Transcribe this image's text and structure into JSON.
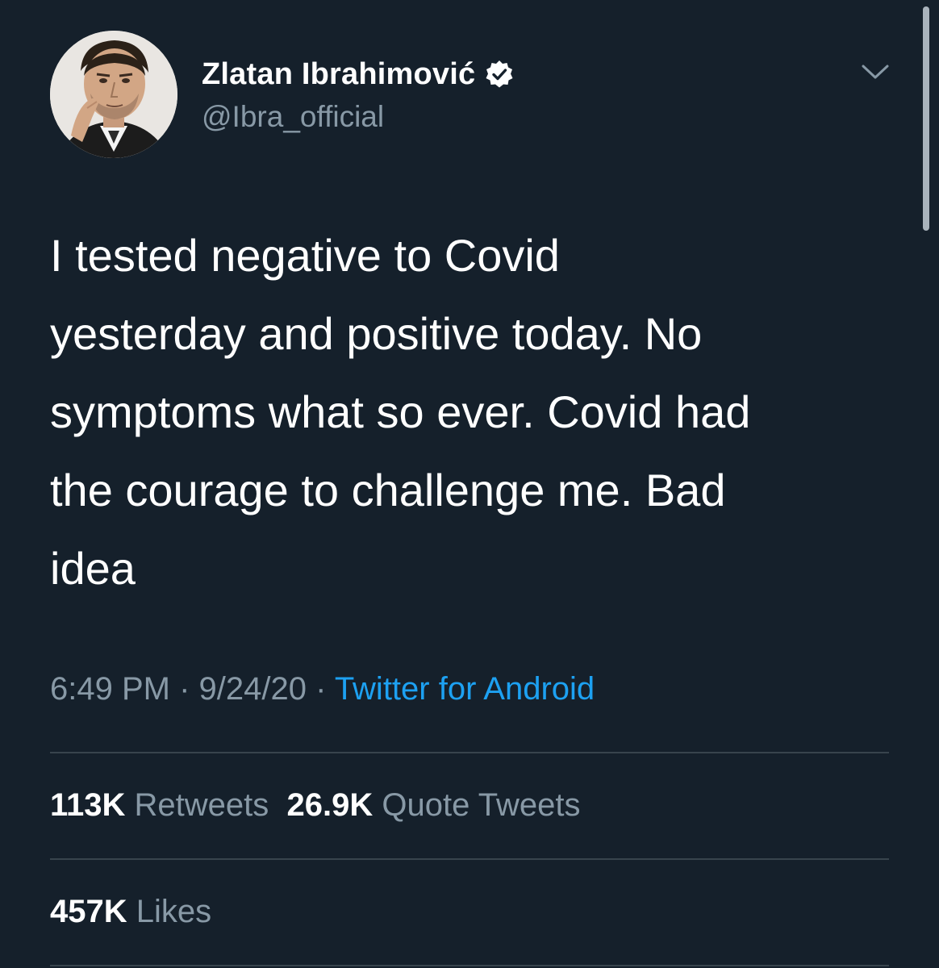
{
  "user": {
    "display_name": "Zlatan Ibrahimović",
    "handle": "@Ibra_official"
  },
  "tweet": {
    "text": "I tested negative to Covid\nyesterday and positive today. No\nsymptoms what so ever. Covid had\nthe courage to challenge me. Bad\nidea",
    "time": "6:49 PM",
    "separator": " · ",
    "date": "9/24/20",
    "source": "Twitter for Android"
  },
  "stats": {
    "retweets_count": "113K",
    "retweets_label": "Retweets",
    "quotes_count": "26.9K",
    "quotes_label": "Quote Tweets",
    "likes_count": "457K",
    "likes_label": "Likes"
  },
  "colors": {
    "background": "#15202b",
    "secondary_text": "#8899a6",
    "link": "#1da1f2",
    "divider": "#38444d"
  },
  "icons": {
    "verified": "verified-badge-icon",
    "caret": "chevron-down-icon"
  }
}
